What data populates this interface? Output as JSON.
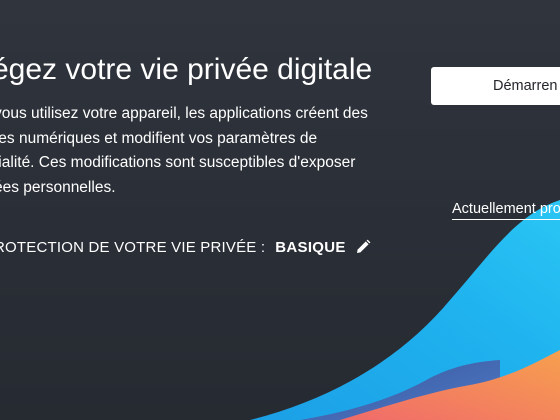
{
  "hero": {
    "headline": "égez votre vie privée digitale",
    "body_lines": [
      "vous utilisez votre appareil, les applications créent des",
      "tes numériques et modifient vos paramètres de",
      "tialité. Ces modifications sont susceptibles d'exposer",
      "ées personnelles."
    ]
  },
  "actions": {
    "start_button_label": "Démarren",
    "current_link_label": "Actuellement pro"
  },
  "protection": {
    "label": "ROTECTION DE VOTRE VIE PRIVÉE :",
    "level": "BASIQUE",
    "edit_icon": "pencil-icon"
  },
  "colors": {
    "background": "#2b2f37",
    "wave_blue": "#1aa7ec",
    "wave_orange": "#f5845a",
    "button_bg": "#ffffff"
  }
}
